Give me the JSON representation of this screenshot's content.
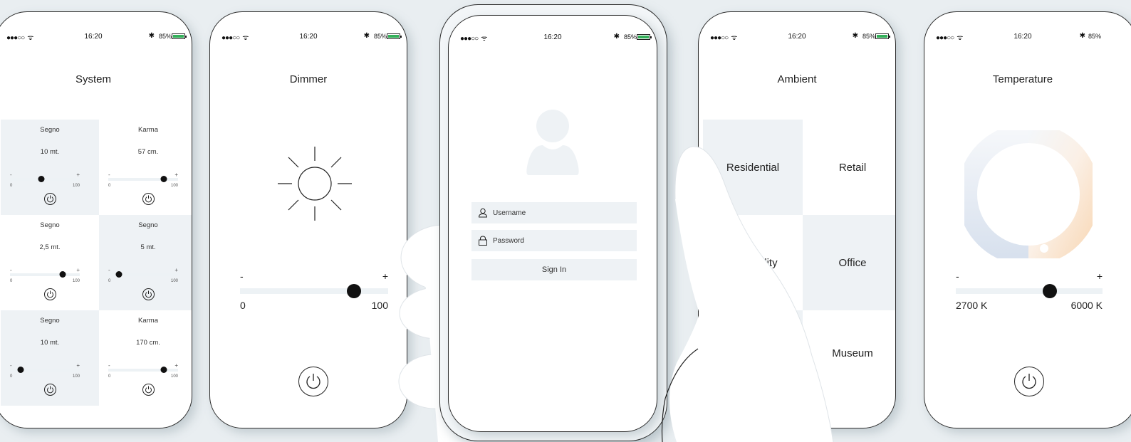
{
  "status": {
    "time": "16:20",
    "battery": "85%",
    "signal_icon": "cellular-signal-icon",
    "wifi_icon": "wifi-icon",
    "bluetooth_icon": "bluetooth-icon",
    "battery_color": "#34b05a"
  },
  "system": {
    "title": "System",
    "cells": [
      {
        "name": "Segno",
        "distance": "10 mt.",
        "min": "0",
        "max": "100",
        "level": 0.45,
        "shaded": true
      },
      {
        "name": "Karma",
        "distance": "57 cm.",
        "min": "0",
        "max": "100",
        "level": 0.8,
        "shaded": false
      },
      {
        "name": "Segno",
        "distance": "2,5 mt.",
        "min": "0",
        "max": "100",
        "level": 0.75,
        "shaded": false
      },
      {
        "name": "Segno",
        "distance": "5 mt.",
        "min": "0",
        "max": "100",
        "level": 0.15,
        "shaded": true
      },
      {
        "name": "Segno",
        "distance": "10 mt.",
        "min": "0",
        "max": "100",
        "level": 0.15,
        "shaded": true
      },
      {
        "name": "Karma",
        "distance": "170 cm.",
        "min": "0",
        "max": "100",
        "level": 0.8,
        "shaded": false
      }
    ]
  },
  "dimmer": {
    "title": "Dimmer",
    "minus": "-",
    "plus": "+",
    "min": "0",
    "max": "100",
    "level": 0.77
  },
  "login": {
    "username_placeholder": "Username",
    "password_placeholder": "Password",
    "sign_in": "Sign In"
  },
  "ambient": {
    "title": "Ambient",
    "items": [
      "Residential",
      "Retail",
      "Hospitality",
      "Office",
      "Museum"
    ]
  },
  "temperature": {
    "title": "Temperature",
    "minus": "-",
    "plus": "+",
    "min": "2700 K",
    "max": "6000 K",
    "level": 0.64
  },
  "colors": {
    "accent_light": "#eef2f5",
    "background": "#e9eef1",
    "warm": "#f8d9b8",
    "cool": "#d8e1ee"
  }
}
